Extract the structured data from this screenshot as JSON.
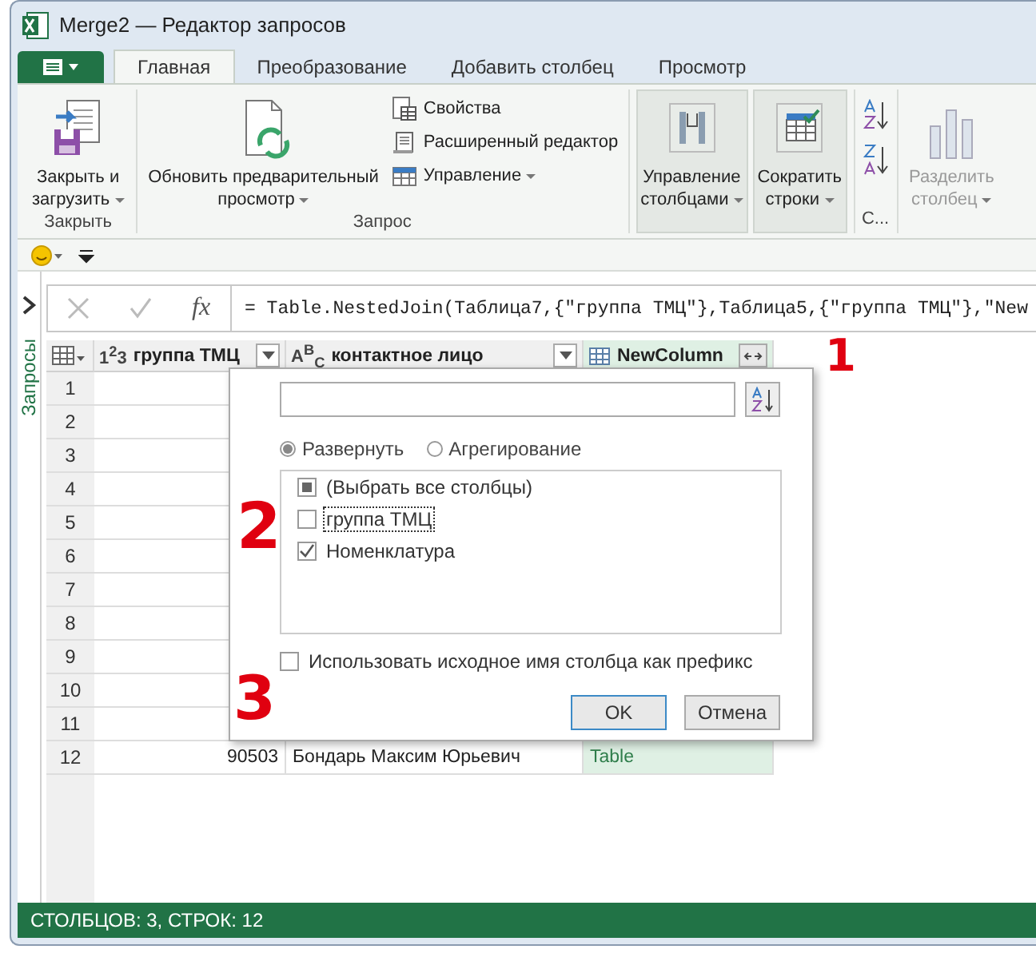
{
  "window": {
    "title": "Merge2 — Редактор запросов"
  },
  "tabs": [
    {
      "label": "Главная",
      "selected": true
    },
    {
      "label": "Преобразование",
      "selected": false
    },
    {
      "label": "Добавить столбец",
      "selected": false
    },
    {
      "label": "Просмотр",
      "selected": false
    }
  ],
  "ribbon": {
    "groups": [
      {
        "label": "Закрыть",
        "items": [
          {
            "kind": "large",
            "label": "Закрыть и\nзагрузить",
            "dropdown": true,
            "pressed": false,
            "disabled": false
          }
        ]
      },
      {
        "label": "Запрос",
        "items": [
          {
            "kind": "large",
            "label": "Обновить предварительный\nпросмотр",
            "dropdown": true,
            "pressed": false,
            "disabled": false
          },
          {
            "kind": "small",
            "label": "Свойства",
            "dropdown": false
          },
          {
            "kind": "small",
            "label": "Расширенный редактор",
            "dropdown": false
          },
          {
            "kind": "small",
            "label": "Управление",
            "dropdown": true
          }
        ]
      },
      {
        "items": [
          {
            "kind": "large",
            "label": "Управление\nстолбцами",
            "dropdown": true,
            "pressed": true,
            "disabled": false
          },
          {
            "kind": "large",
            "label": "Сократить\nстроки",
            "dropdown": true,
            "pressed": true,
            "disabled": false
          }
        ]
      },
      {
        "label": "С...",
        "items": [
          {
            "kind": "sort"
          }
        ]
      },
      {
        "items": [
          {
            "kind": "large",
            "label": "Разделить\nстолбец",
            "dropdown": true,
            "pressed": false,
            "disabled": true
          }
        ]
      }
    ]
  },
  "sidebar": {
    "title": "Запросы"
  },
  "formula_bar": {
    "function_symbol": "fx",
    "formula": "= Table.NestedJoin(Таблица7,{\"группа ТМЦ\"},Таблица5,{\"группа ТМЦ\"},\"New"
  },
  "table": {
    "columns": [
      {
        "kind": "number",
        "type_label": "1$^{2}$3",
        "name": "группа ТМЦ"
      },
      {
        "kind": "text",
        "type_label": "A$^{B}$$_{C}$",
        "name": "контактное лицо"
      },
      {
        "kind": "table",
        "name": "NewColumn"
      }
    ],
    "rows": [
      {
        "number": "1"
      },
      {
        "number": "2"
      },
      {
        "number": "3"
      },
      {
        "number": "4"
      },
      {
        "number": "5"
      },
      {
        "number": "6"
      },
      {
        "number": "7"
      },
      {
        "number": "8"
      },
      {
        "number": "9"
      },
      {
        "number": "10"
      },
      {
        "number": "11"
      },
      {
        "number": "12",
        "cells": [
          "90503",
          "Бондарь Максим Юрьевич",
          "Table"
        ]
      }
    ]
  },
  "expand_dialog": {
    "modes": [
      {
        "label": "Развернуть",
        "selected": true
      },
      {
        "label": "Агрегирование",
        "selected": false
      }
    ],
    "columns": [
      {
        "label": "(Выбрать все столбцы)",
        "indeterminate": true,
        "focused": false
      },
      {
        "label": "группа ТМЦ",
        "checked": false,
        "focused": true
      },
      {
        "label": "Номенклатура",
        "checked": true,
        "focused": false
      }
    ],
    "prefix_option": {
      "label": "Использовать исходное имя столбца как префикс",
      "checked": false
    },
    "buttons": [
      {
        "label": "OK",
        "default": true
      },
      {
        "label": "Отмена",
        "default": false
      }
    ]
  },
  "annotations": [
    {
      "text": "1"
    },
    {
      "text": "2"
    },
    {
      "text": "3"
    }
  ],
  "status_bar": {
    "text": "СТОЛБЦОВ: 3, СТРОК: 12"
  }
}
